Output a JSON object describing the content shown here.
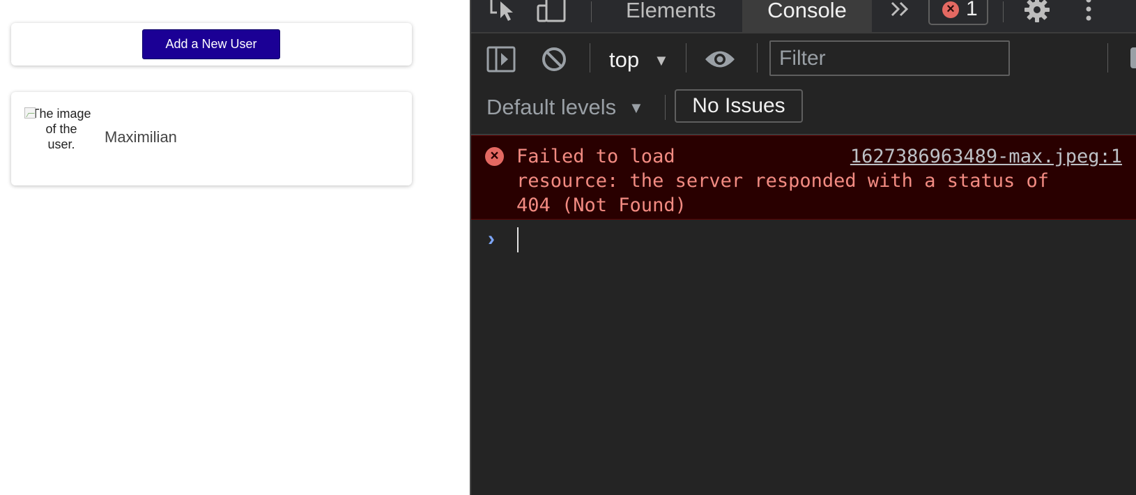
{
  "page": {
    "add_user_button": "Add a New User",
    "user": {
      "image_alt": "The image of the user.",
      "name": "Maximilian"
    }
  },
  "devtools": {
    "tabs": [
      {
        "label": "Elements",
        "active": false
      },
      {
        "label": "Console",
        "active": true
      }
    ],
    "error_count": "1",
    "context": "top",
    "filter_placeholder": "Filter",
    "levels": "Default levels",
    "issues": "No Issues",
    "error": {
      "message": "Failed to load\nresource: the server responded with a status of\n404 (Not Found)",
      "source": "1627386963489-max.jpeg:1"
    }
  },
  "colors": {
    "button_bg": "#1b0095",
    "devtools_bg": "#242424",
    "error_bg": "#290000",
    "error_text": "#f28b82",
    "prompt": "#7ca4f4"
  }
}
